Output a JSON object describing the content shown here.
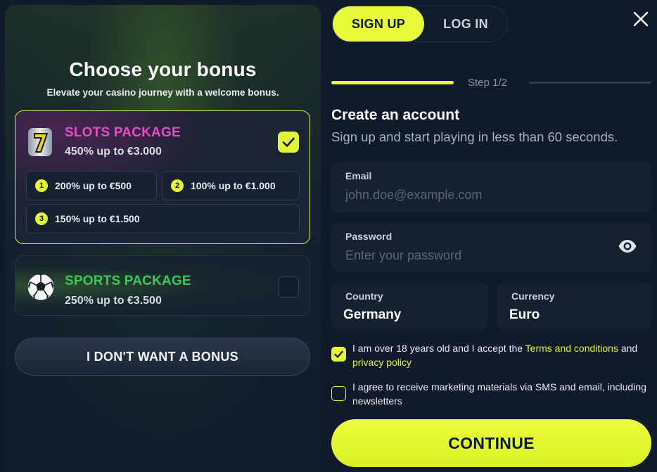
{
  "bonus_panel": {
    "title": "Choose your bonus",
    "subtitle": "Elevate your casino journey with a welcome bonus.",
    "packages": [
      {
        "name": "SLOTS PACKAGE",
        "offer": "450% up to €3.000",
        "selected": true,
        "icon": "slot-seven-icon",
        "tiers": [
          {
            "num": "1",
            "label": "200% up to €500"
          },
          {
            "num": "2",
            "label": "100% up to €1.000"
          },
          {
            "num": "3",
            "label": "150% up to €1.500"
          }
        ]
      },
      {
        "name": "SPORTS PACKAGE",
        "offer": "250% up to €3.500",
        "selected": false,
        "icon": "soccer-ball-icon"
      }
    ],
    "no_bonus_label": "I DON'T WANT A BONUS"
  },
  "auth": {
    "tabs": [
      {
        "label": "SIGN UP",
        "active": true
      },
      {
        "label": "LOG IN",
        "active": false
      }
    ],
    "close_icon": "close-icon",
    "step_label": "Step 1/2",
    "step_progress": 0.5,
    "form_title": "Create an account",
    "form_subtitle": "Sign up and start playing in less than 60 seconds.",
    "email": {
      "label": "Email",
      "placeholder": "john.doe@example.com",
      "value": ""
    },
    "password": {
      "label": "Password",
      "placeholder": "Enter your password",
      "value": "",
      "icon": "eye-icon"
    },
    "country": {
      "label": "Country",
      "value": "Germany"
    },
    "currency": {
      "label": "Currency",
      "value": "Euro"
    },
    "terms": {
      "checked": true,
      "text_before": "I am over 18 years old and I accept the ",
      "terms_link": "Terms and conditions",
      "text_and": " and ",
      "privacy_link": "privacy policy"
    },
    "marketing": {
      "checked": false,
      "text": "I agree to receive marketing materials via SMS and email, including newsletters"
    },
    "continue_label": "CONTINUE"
  },
  "colors": {
    "accent": "#e6f93b",
    "background": "#101a2a",
    "slots_pink": "#e64cc3",
    "sports_green": "#42c55a"
  }
}
